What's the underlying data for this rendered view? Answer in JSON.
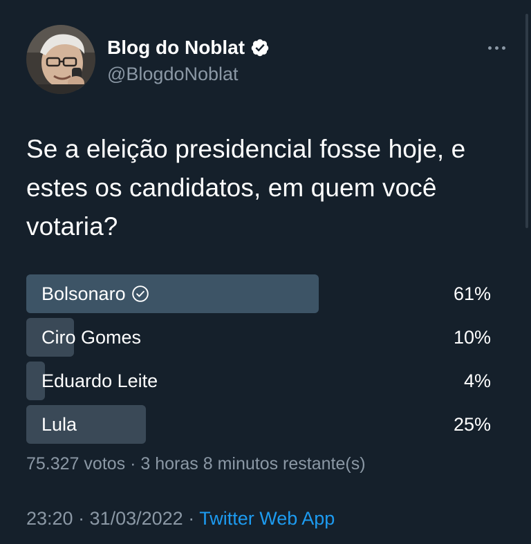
{
  "author": {
    "name": "Blog do Noblat",
    "handle": "@BlogdoNoblat",
    "verified": true
  },
  "tweet": {
    "text": "Se a eleição presidencial fosse hoje, e estes os candidatos, em quem você votaria?"
  },
  "poll": {
    "options": [
      {
        "label": "Bolsonaro",
        "percent": "61%",
        "value": 0.61,
        "voted": true
      },
      {
        "label": "Ciro Gomes",
        "percent": "10%",
        "value": 0.1,
        "voted": false
      },
      {
        "label": "Eduardo Leite",
        "percent": "4%",
        "value": 0.04,
        "voted": false
      },
      {
        "label": "Lula",
        "percent": "25%",
        "value": 0.25,
        "voted": false
      }
    ],
    "meta": "75.327 votos · 3 horas 8 minutos restante(s)"
  },
  "timestamp": {
    "time": "23:20 · 31/03/2022 · ",
    "source": "Twitter Web App"
  },
  "icons": {
    "verified": "verified-badge-icon",
    "voted": "check-circle-icon",
    "more": "more-dots-icon"
  },
  "colors": {
    "background": "#15202b",
    "bar": "#3a4957",
    "bar_winner": "#3d5466",
    "muted_text": "#8b98a5",
    "link": "#1d9bf0"
  }
}
